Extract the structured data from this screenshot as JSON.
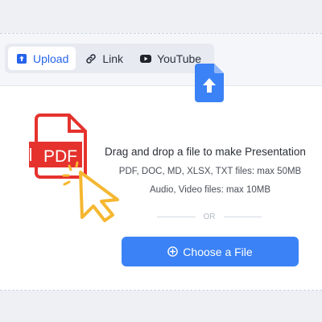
{
  "tabs": [
    {
      "label": "Upload",
      "icon": "upload-icon",
      "active": true
    },
    {
      "label": "Link",
      "icon": "link-icon",
      "active": false
    },
    {
      "label": "YouTube",
      "icon": "youtube-icon",
      "active": false
    }
  ],
  "dropzone": {
    "title": "Drag and drop a file to make Presentation",
    "formats_line": "PDF, DOC, MD, XLSX, TXT files: max 50MB",
    "media_line": "Audio, Video files: max 10MB",
    "or_label": "OR",
    "choose_label": "Choose a File",
    "illustration_text": "PDF"
  },
  "colors": {
    "accent": "#3b82f6",
    "pdf_red": "#e5322d",
    "cursor_yellow": "#f5b731"
  }
}
